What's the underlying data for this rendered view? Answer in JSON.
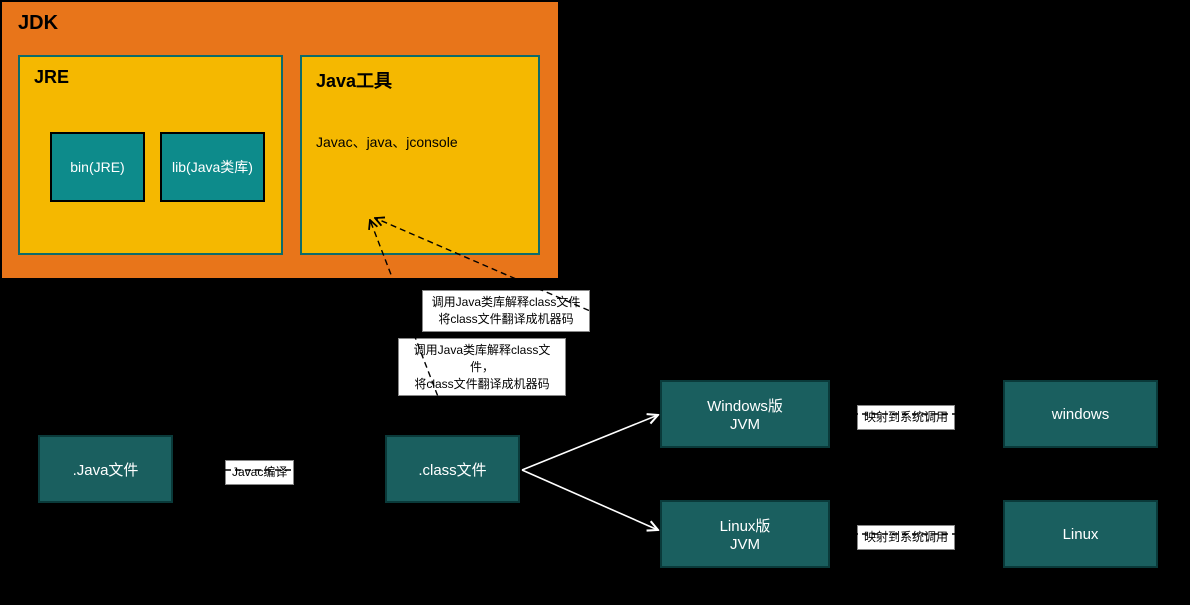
{
  "jdk": {
    "label": "JDK",
    "jre": {
      "label": "JRE",
      "bin": "bin(JRE)",
      "lib": "lib(Java类库)"
    },
    "tools": {
      "label": "Java工具",
      "items": "Javac、java、jconsole"
    }
  },
  "nodes": {
    "java_file": ".Java文件",
    "class_file": ".class文件",
    "win_jvm_line1": "Windows版",
    "win_jvm_line2": "JVM",
    "linux_jvm_line1": "Linux版",
    "linux_jvm_line2": "JVM",
    "windows": "windows",
    "linux": "Linux"
  },
  "edges": {
    "javac": "Javac编译",
    "lib_note1_line1": "调用Java类库解释class文件，",
    "lib_note1_line2": "将class文件翻译成机器码",
    "lib_note2_line1": "调用Java类库解释class文件",
    "lib_note2_line2": "将class文件翻译成机器码",
    "map_win": "映射到系统调用",
    "map_linux": "映射到系统调用"
  }
}
